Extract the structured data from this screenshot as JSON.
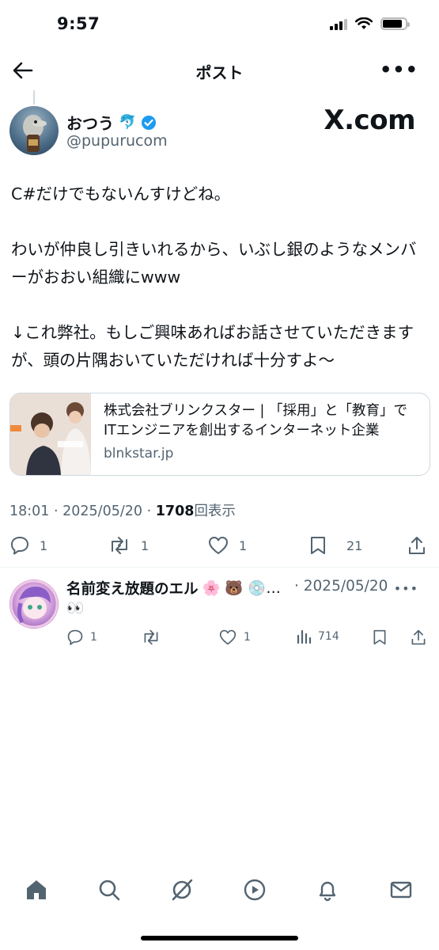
{
  "status": {
    "time": "9:57"
  },
  "header": {
    "title": "ポスト"
  },
  "tweet": {
    "author_name": "おつう",
    "author_handle": "@pupurucom",
    "watermark": "X.com",
    "text": "C#だけでもないんすけどね。\n\nわいが仲良し引きいれるから、いぶし銀のようなメンバーがおおい組織にwww\n\n↓これ弊社。もしご興味あればお話させていただきますが、頭の片隅おいていただければ十分すよ〜",
    "card": {
      "title_line1": "株式会社ブリンクスター | 「採用」と「教育」で",
      "title_line2": "ITエンジニアを創出するインターネット企業",
      "domain": "blnkstar.jp"
    },
    "meta": {
      "time": "18:01",
      "date": "2025/05/20",
      "views": "1708",
      "views_label": "回表示",
      "sep": " · "
    },
    "actions": {
      "replies": "1",
      "reposts": "1",
      "likes": "1",
      "bookmarks": "21"
    }
  },
  "reply": {
    "name": "名前変え放題のエル",
    "emojis": "🌸 🐻 💿…",
    "date": "· 2025/05/20",
    "text": "👀",
    "actions": {
      "replies": "1",
      "likes": "1",
      "views": "714"
    }
  },
  "colors": {
    "secondary_text": "#536471",
    "primary_text": "#0f1419",
    "verified": "#1d9bf0"
  },
  "nav": [
    "home-icon",
    "search-icon",
    "grok-icon",
    "video-icon",
    "notifications-icon",
    "messages-icon"
  ]
}
